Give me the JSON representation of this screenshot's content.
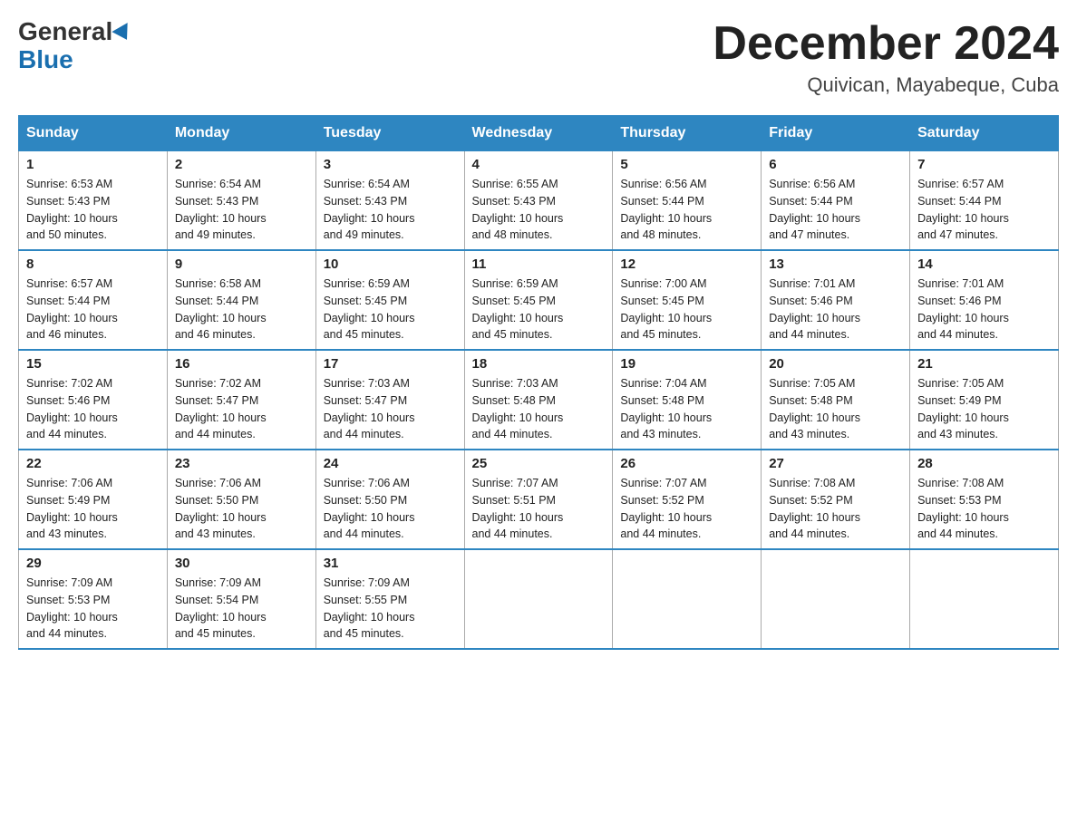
{
  "logo": {
    "text_general": "General",
    "text_blue": "Blue"
  },
  "title": "December 2024",
  "location": "Quivican, Mayabeque, Cuba",
  "weekdays": [
    "Sunday",
    "Monday",
    "Tuesday",
    "Wednesday",
    "Thursday",
    "Friday",
    "Saturday"
  ],
  "weeks": [
    [
      {
        "day": "1",
        "sunrise": "6:53 AM",
        "sunset": "5:43 PM",
        "daylight": "10 hours and 50 minutes."
      },
      {
        "day": "2",
        "sunrise": "6:54 AM",
        "sunset": "5:43 PM",
        "daylight": "10 hours and 49 minutes."
      },
      {
        "day": "3",
        "sunrise": "6:54 AM",
        "sunset": "5:43 PM",
        "daylight": "10 hours and 49 minutes."
      },
      {
        "day": "4",
        "sunrise": "6:55 AM",
        "sunset": "5:43 PM",
        "daylight": "10 hours and 48 minutes."
      },
      {
        "day": "5",
        "sunrise": "6:56 AM",
        "sunset": "5:44 PM",
        "daylight": "10 hours and 48 minutes."
      },
      {
        "day": "6",
        "sunrise": "6:56 AM",
        "sunset": "5:44 PM",
        "daylight": "10 hours and 47 minutes."
      },
      {
        "day": "7",
        "sunrise": "6:57 AM",
        "sunset": "5:44 PM",
        "daylight": "10 hours and 47 minutes."
      }
    ],
    [
      {
        "day": "8",
        "sunrise": "6:57 AM",
        "sunset": "5:44 PM",
        "daylight": "10 hours and 46 minutes."
      },
      {
        "day": "9",
        "sunrise": "6:58 AM",
        "sunset": "5:44 PM",
        "daylight": "10 hours and 46 minutes."
      },
      {
        "day": "10",
        "sunrise": "6:59 AM",
        "sunset": "5:45 PM",
        "daylight": "10 hours and 45 minutes."
      },
      {
        "day": "11",
        "sunrise": "6:59 AM",
        "sunset": "5:45 PM",
        "daylight": "10 hours and 45 minutes."
      },
      {
        "day": "12",
        "sunrise": "7:00 AM",
        "sunset": "5:45 PM",
        "daylight": "10 hours and 45 minutes."
      },
      {
        "day": "13",
        "sunrise": "7:01 AM",
        "sunset": "5:46 PM",
        "daylight": "10 hours and 44 minutes."
      },
      {
        "day": "14",
        "sunrise": "7:01 AM",
        "sunset": "5:46 PM",
        "daylight": "10 hours and 44 minutes."
      }
    ],
    [
      {
        "day": "15",
        "sunrise": "7:02 AM",
        "sunset": "5:46 PM",
        "daylight": "10 hours and 44 minutes."
      },
      {
        "day": "16",
        "sunrise": "7:02 AM",
        "sunset": "5:47 PM",
        "daylight": "10 hours and 44 minutes."
      },
      {
        "day": "17",
        "sunrise": "7:03 AM",
        "sunset": "5:47 PM",
        "daylight": "10 hours and 44 minutes."
      },
      {
        "day": "18",
        "sunrise": "7:03 AM",
        "sunset": "5:48 PM",
        "daylight": "10 hours and 44 minutes."
      },
      {
        "day": "19",
        "sunrise": "7:04 AM",
        "sunset": "5:48 PM",
        "daylight": "10 hours and 43 minutes."
      },
      {
        "day": "20",
        "sunrise": "7:05 AM",
        "sunset": "5:48 PM",
        "daylight": "10 hours and 43 minutes."
      },
      {
        "day": "21",
        "sunrise": "7:05 AM",
        "sunset": "5:49 PM",
        "daylight": "10 hours and 43 minutes."
      }
    ],
    [
      {
        "day": "22",
        "sunrise": "7:06 AM",
        "sunset": "5:49 PM",
        "daylight": "10 hours and 43 minutes."
      },
      {
        "day": "23",
        "sunrise": "7:06 AM",
        "sunset": "5:50 PM",
        "daylight": "10 hours and 43 minutes."
      },
      {
        "day": "24",
        "sunrise": "7:06 AM",
        "sunset": "5:50 PM",
        "daylight": "10 hours and 44 minutes."
      },
      {
        "day": "25",
        "sunrise": "7:07 AM",
        "sunset": "5:51 PM",
        "daylight": "10 hours and 44 minutes."
      },
      {
        "day": "26",
        "sunrise": "7:07 AM",
        "sunset": "5:52 PM",
        "daylight": "10 hours and 44 minutes."
      },
      {
        "day": "27",
        "sunrise": "7:08 AM",
        "sunset": "5:52 PM",
        "daylight": "10 hours and 44 minutes."
      },
      {
        "day": "28",
        "sunrise": "7:08 AM",
        "sunset": "5:53 PM",
        "daylight": "10 hours and 44 minutes."
      }
    ],
    [
      {
        "day": "29",
        "sunrise": "7:09 AM",
        "sunset": "5:53 PM",
        "daylight": "10 hours and 44 minutes."
      },
      {
        "day": "30",
        "sunrise": "7:09 AM",
        "sunset": "5:54 PM",
        "daylight": "10 hours and 45 minutes."
      },
      {
        "day": "31",
        "sunrise": "7:09 AM",
        "sunset": "5:55 PM",
        "daylight": "10 hours and 45 minutes."
      },
      null,
      null,
      null,
      null
    ]
  ],
  "labels": {
    "sunrise": "Sunrise:",
    "sunset": "Sunset:",
    "daylight": "Daylight:"
  }
}
